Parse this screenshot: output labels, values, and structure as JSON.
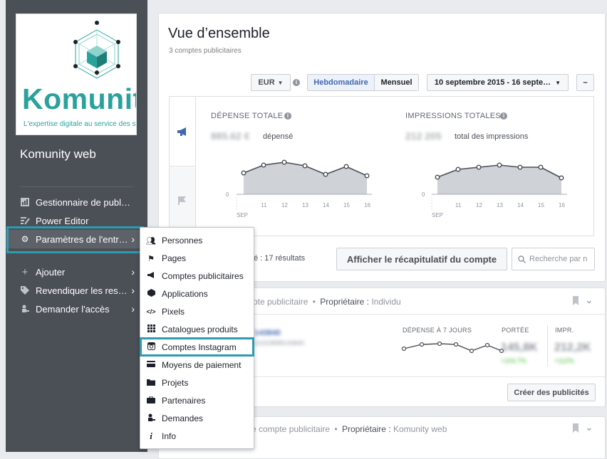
{
  "sidebar": {
    "logo": {
      "word": "Komunity",
      "tagline": "L'expertise digitale au service des stra"
    },
    "brand_name": "Komunity web",
    "items": [
      {
        "label": "Gestionnaire de publ…",
        "icon": "bar-chart-icon",
        "has_chevron": false
      },
      {
        "label": "Power Editor",
        "icon": "pencil-lines-icon",
        "has_chevron": false
      },
      {
        "label": "Paramètres de l'entr…",
        "icon": "gear-icon",
        "has_chevron": true,
        "active": true
      },
      {
        "label": "Ajouter",
        "icon": "plus-icon",
        "has_chevron": true
      },
      {
        "label": "Revendiquer les res…",
        "icon": "tag-icon",
        "has_chevron": true
      },
      {
        "label": "Demander l'accès",
        "icon": "person-key-icon",
        "has_chevron": true
      }
    ]
  },
  "overview": {
    "title": "Vue d’ensemble",
    "subtitle": "3 comptes publicitaires",
    "currency": "EUR",
    "period_weekly": "Hebdomadaire",
    "period_monthly": "Mensuel",
    "date_range": "10 septembre 2015 - 16 septe…",
    "collapse_label": "–",
    "spend": {
      "label": "DÉPENSE TOTALE",
      "value": "885.62 €",
      "unit": "dépensé"
    },
    "impressions": {
      "label": "IMPRESSIONS TOTALES",
      "value": "212 205",
      "unit": "total des impressions"
    },
    "x_ticks": [
      "11",
      "12",
      "13",
      "14",
      "15",
      "16"
    ],
    "month_label": "SEP",
    "zero_label": "0",
    "results_text": "é : 17 résultats",
    "recap_button": "Afficher le récapitulatif du compte",
    "search_placeholder": "Recherche par n"
  },
  "accounts": [
    {
      "header_prefix": "mpte publicitaire",
      "owner_label": "Propriétaire :",
      "owner_value": "Individu",
      "account_id": "143840",
      "account_sub": "10153898143840",
      "spend_label": "DÉPENSE À 7 JOURS",
      "reach_label": "PORTÉE",
      "impr_label": "IMPR.",
      "reach_value": "145,8K",
      "reach_delta": "+104,7%",
      "impr_value": "212,2K",
      "impr_delta": "+112%",
      "create_button": "Créer des publicités"
    },
    {
      "header_prefix": "e compte publicitaire",
      "owner_label": "Propriétaire :",
      "owner_value": "Komunity web"
    }
  ],
  "menu": {
    "items": [
      {
        "label": "Personnes",
        "icon": "people-icon"
      },
      {
        "label": "Pages",
        "icon": "flag-icon"
      },
      {
        "label": "Comptes publicitaires",
        "icon": "megaphone-icon"
      },
      {
        "label": "Applications",
        "icon": "cube-icon"
      },
      {
        "label": "Pixels",
        "icon": "code-icon"
      },
      {
        "label": "Catalogues produits",
        "icon": "grid-icon"
      },
      {
        "label": "Comptes Instagram",
        "icon": "instagram-icon"
      },
      {
        "label": "Moyens de paiement",
        "icon": "credit-card-icon"
      },
      {
        "label": "Projets",
        "icon": "folder-icon"
      },
      {
        "label": "Partenaires",
        "icon": "briefcase-icon"
      },
      {
        "label": "Demandes",
        "icon": "person-key-icon"
      },
      {
        "label": "Info",
        "icon": "info-icon"
      }
    ]
  },
  "colors": {
    "sidebar": "#4b4f56",
    "accent": "#2e9bb3",
    "brand": "#2aa29b",
    "link": "#4267b2"
  }
}
